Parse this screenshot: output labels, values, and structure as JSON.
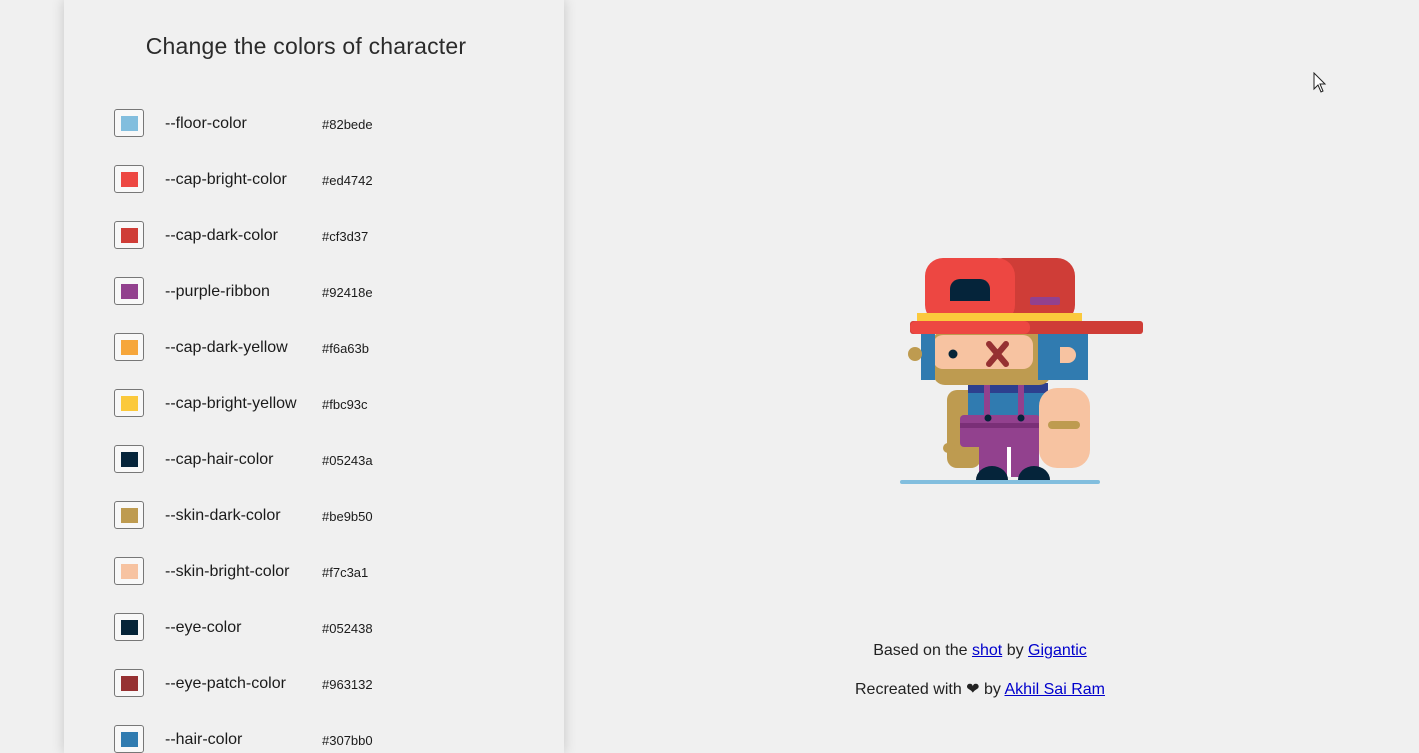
{
  "panel": {
    "title": "Change the colors of character",
    "rows": [
      {
        "name": "--floor-color",
        "hex": "#82bede",
        "color": "#82bede"
      },
      {
        "name": "--cap-bright-color",
        "hex": "#ed4742",
        "color": "#ed4742"
      },
      {
        "name": "--cap-dark-color",
        "hex": "#cf3d37",
        "color": "#cf3d37"
      },
      {
        "name": "--purple-ribbon",
        "hex": "#92418e",
        "color": "#92418e"
      },
      {
        "name": "--cap-dark-yellow",
        "hex": "#f6a63b",
        "color": "#f6a63b"
      },
      {
        "name": "--cap-bright-yellow",
        "hex": "#fbc93c",
        "color": "#fbc93c"
      },
      {
        "name": "--cap-hair-color",
        "hex": "#05243a",
        "color": "#05243a"
      },
      {
        "name": "--skin-dark-color",
        "hex": "#be9b50",
        "color": "#be9b50"
      },
      {
        "name": "--skin-bright-color",
        "hex": "#f7c3a1",
        "color": "#f7c3a1"
      },
      {
        "name": "--eye-color",
        "hex": "#052438",
        "color": "#052438"
      },
      {
        "name": "--eye-patch-color",
        "hex": "#963132",
        "color": "#963132"
      },
      {
        "name": "--hair-color",
        "hex": "#307bb0",
        "color": "#307bb0"
      }
    ]
  },
  "credits": {
    "line1_prefix": "Based on the",
    "line1_link1": "shot",
    "line1_mid": "by",
    "line1_link2": "Gigantic",
    "line2_prefix": "Recreated with",
    "line2_heart": "❤",
    "line2_mid": "by",
    "line2_link": "Akhil Sai Ram"
  },
  "icons": {
    "heart": "heart-icon",
    "cursor": "mouse-cursor-icon"
  }
}
